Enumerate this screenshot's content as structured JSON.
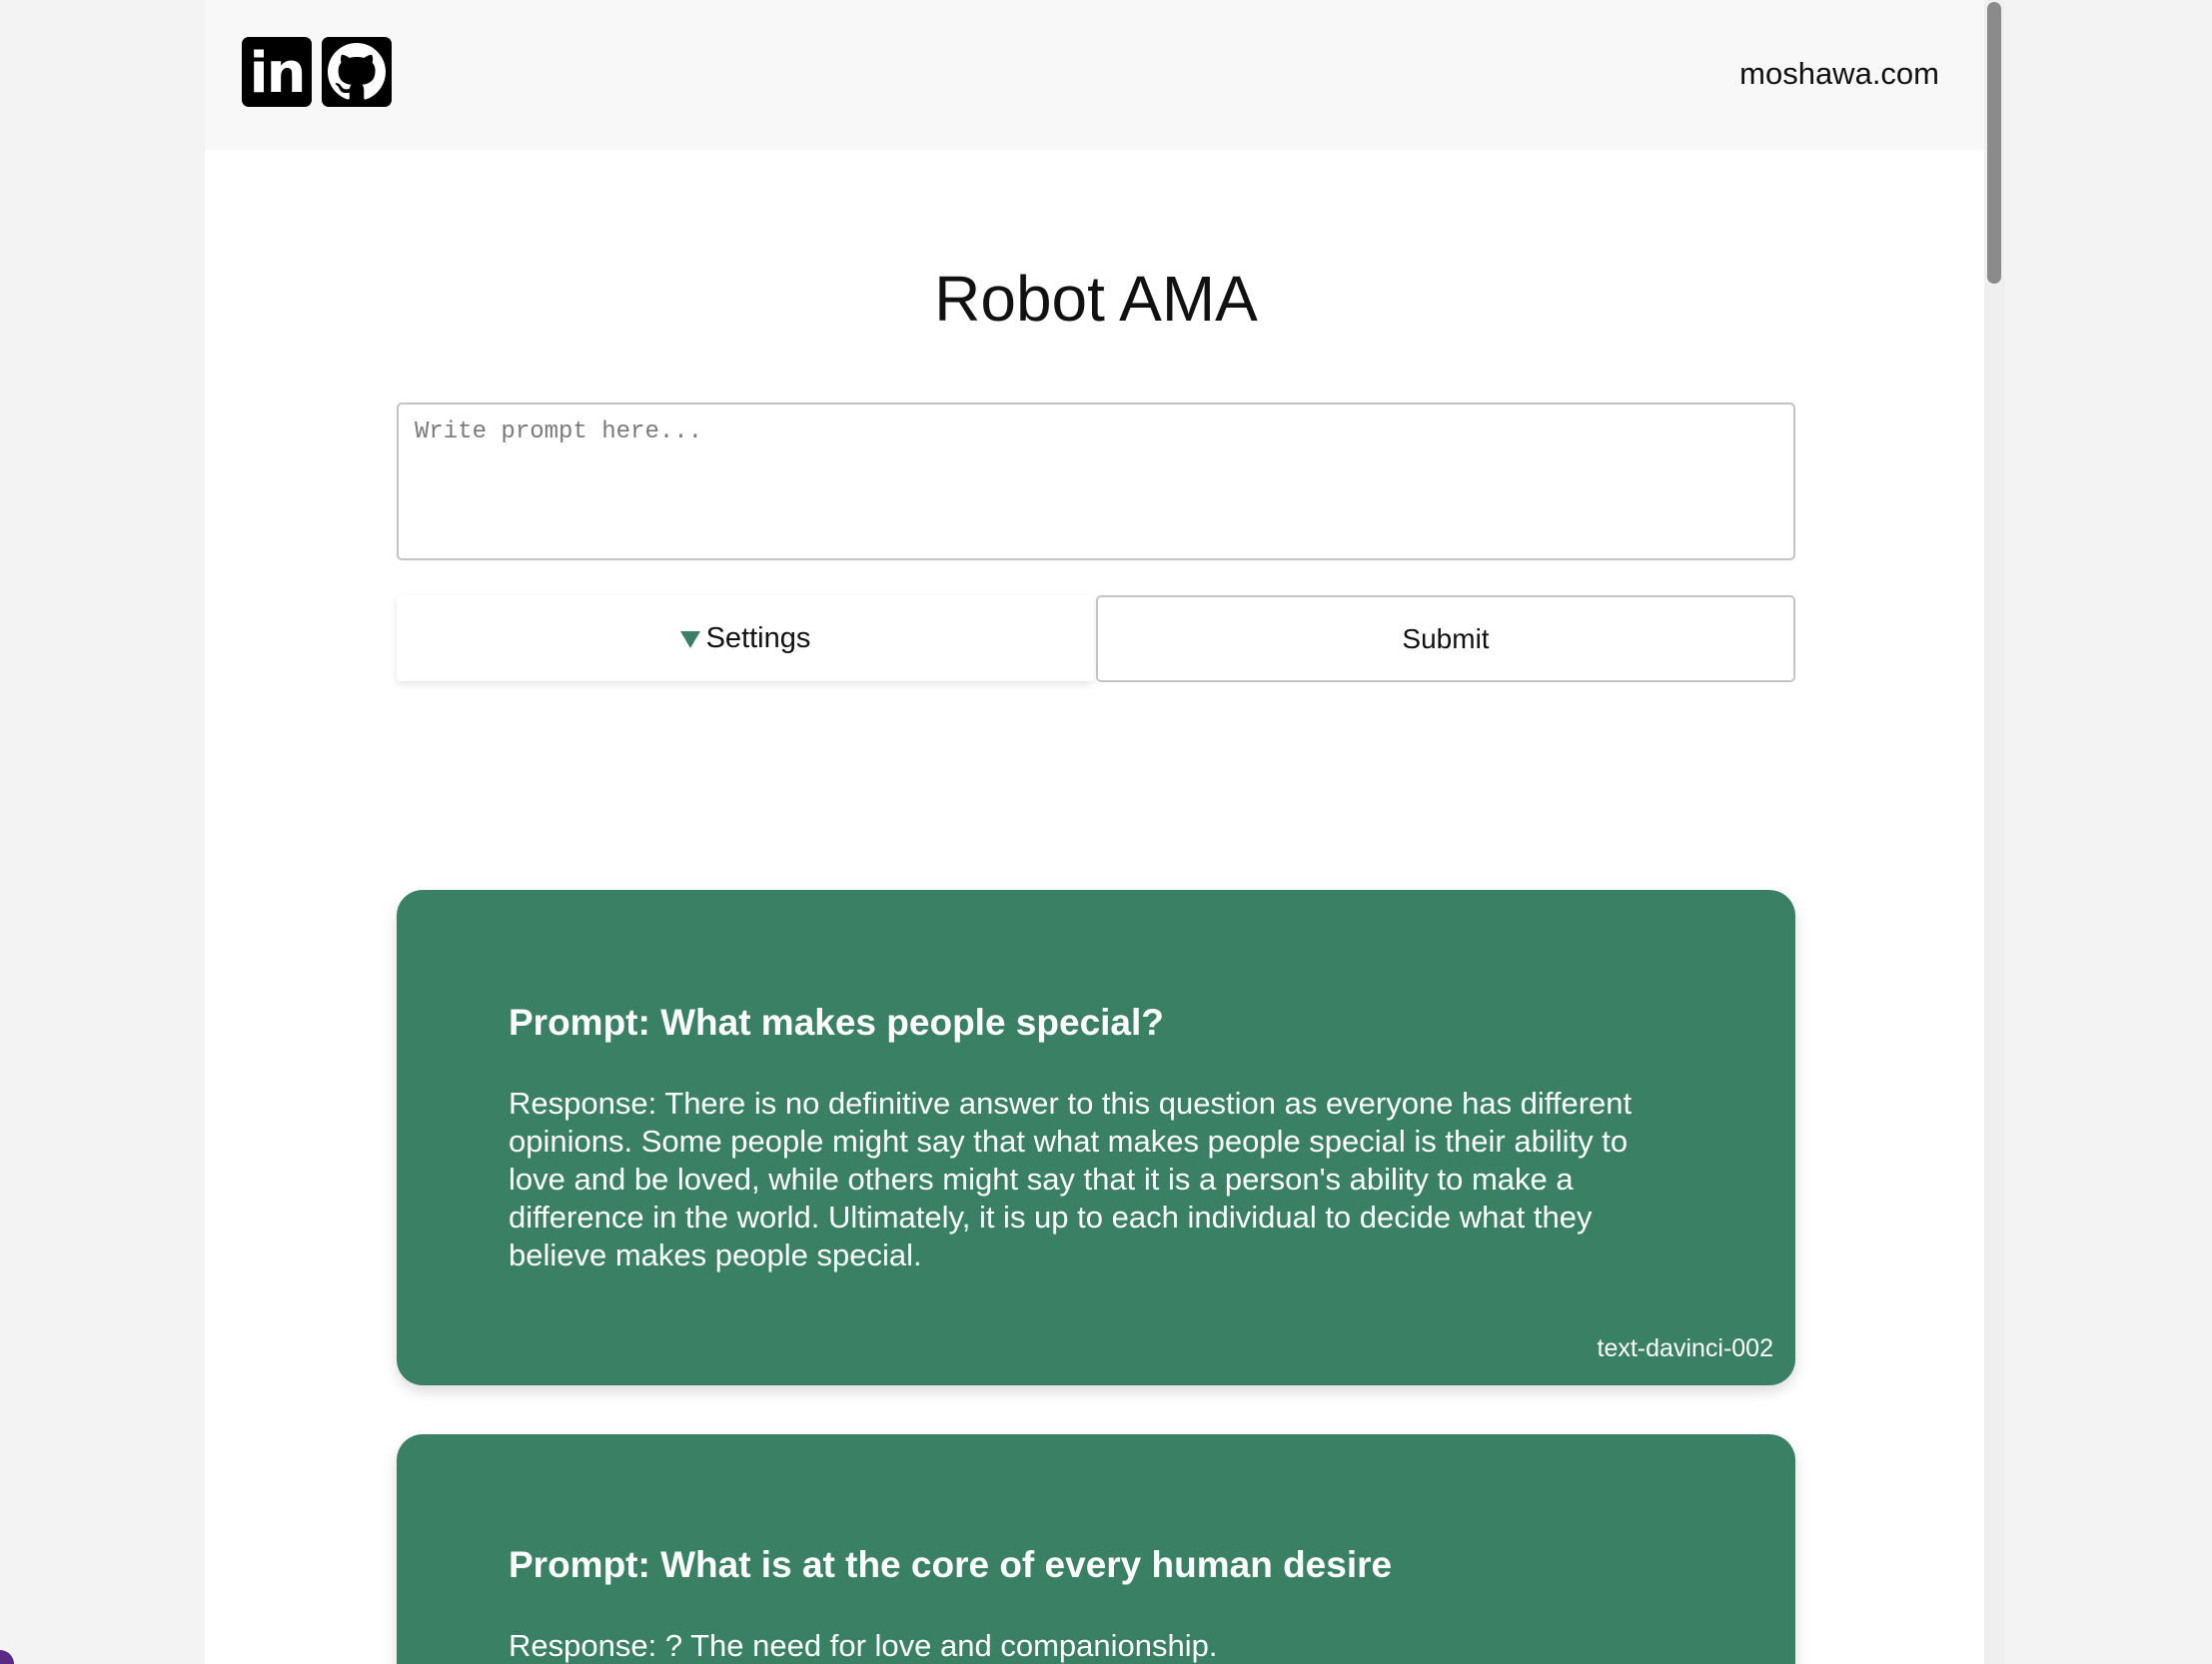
{
  "header": {
    "social": [
      {
        "icon": "linkedin-icon",
        "label": "in"
      },
      {
        "icon": "github-icon"
      }
    ],
    "site_link": "moshawa.com"
  },
  "main": {
    "title": "Robot AMA",
    "prompt_placeholder": "Write prompt here...",
    "settings_label": "Settings",
    "submit_label": "Submit"
  },
  "colors": {
    "accent": "#3a8064",
    "card_text": "#ffffff"
  },
  "responses": [
    {
      "prompt": "Prompt: What makes people special?",
      "response": "Response: There is no definitive answer to this question as everyone has different opinions. Some people might say that what makes people special is their ability to love and be loved, while others might say that it is a person's ability to make a difference in the world. Ultimately, it is up to each individual to decide what they believe makes people special.",
      "model": "text-davinci-002"
    },
    {
      "prompt": "Prompt: What is at the core of every human desire",
      "response": "Response: ? The need for love and companionship."
    }
  ]
}
